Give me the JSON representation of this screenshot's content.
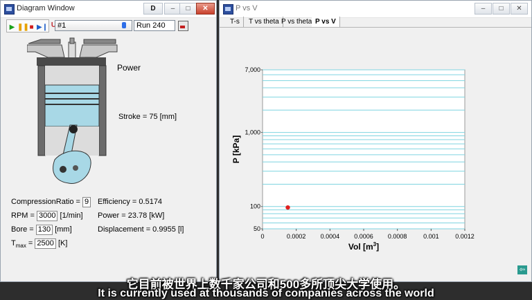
{
  "diagram_window": {
    "title": "Diagram Window",
    "d_button": "D",
    "toolbar": {
      "run_label": "#1",
      "run_name": "Run 240"
    },
    "engine": {
      "power_label": "Power",
      "stroke_label": "Stroke = 75 [mm]"
    },
    "params": {
      "compression_label": "CompressionRatio =",
      "compression_value": "9",
      "efficiency": "Efficiency = 0.5174",
      "rpm_label": "RPM =",
      "rpm_value": "3000",
      "rpm_unit": "[1/min]",
      "power": "Power = 23.78 [kW]",
      "bore_label": "Bore =",
      "bore_value": "130",
      "bore_unit": "[mm]",
      "displacement": "Displacement = 0.9955 [l]",
      "tmax_label": "T",
      "tmax_sub": "max",
      "tmax_eq": "=",
      "tmax_value": "2500",
      "tmax_unit": "[K]"
    }
  },
  "plot_window": {
    "title": "P vs V",
    "tabs": [
      "T-s",
      "T vs theta",
      "P vs theta",
      "P vs V"
    ],
    "active_tab": "P vs V"
  },
  "chart_data": {
    "type": "scatter",
    "xlabel": "Vol [m3]",
    "ylabel": "P [kPa]",
    "xlim": [
      0,
      0.0012
    ],
    "ylim": [
      50,
      7000
    ],
    "yscale": "log",
    "x_ticks": [
      "0",
      "0.0002",
      "0.0004",
      "0.0006",
      "0.0008",
      "0.001",
      "0.0012"
    ],
    "y_ticks": [
      "50",
      "100",
      "1,000",
      "7,000"
    ],
    "grid": "horizontal",
    "points": [
      {
        "x": 0.00015,
        "y": 97
      }
    ],
    "colors": {
      "point": "#e02020",
      "grid": "#7fd4e0"
    }
  },
  "subtitles": {
    "zh": "它目前被世界上数千家公司和500多所顶尖大学使用。",
    "en": "It is currently used at thousands of companies across the world"
  }
}
